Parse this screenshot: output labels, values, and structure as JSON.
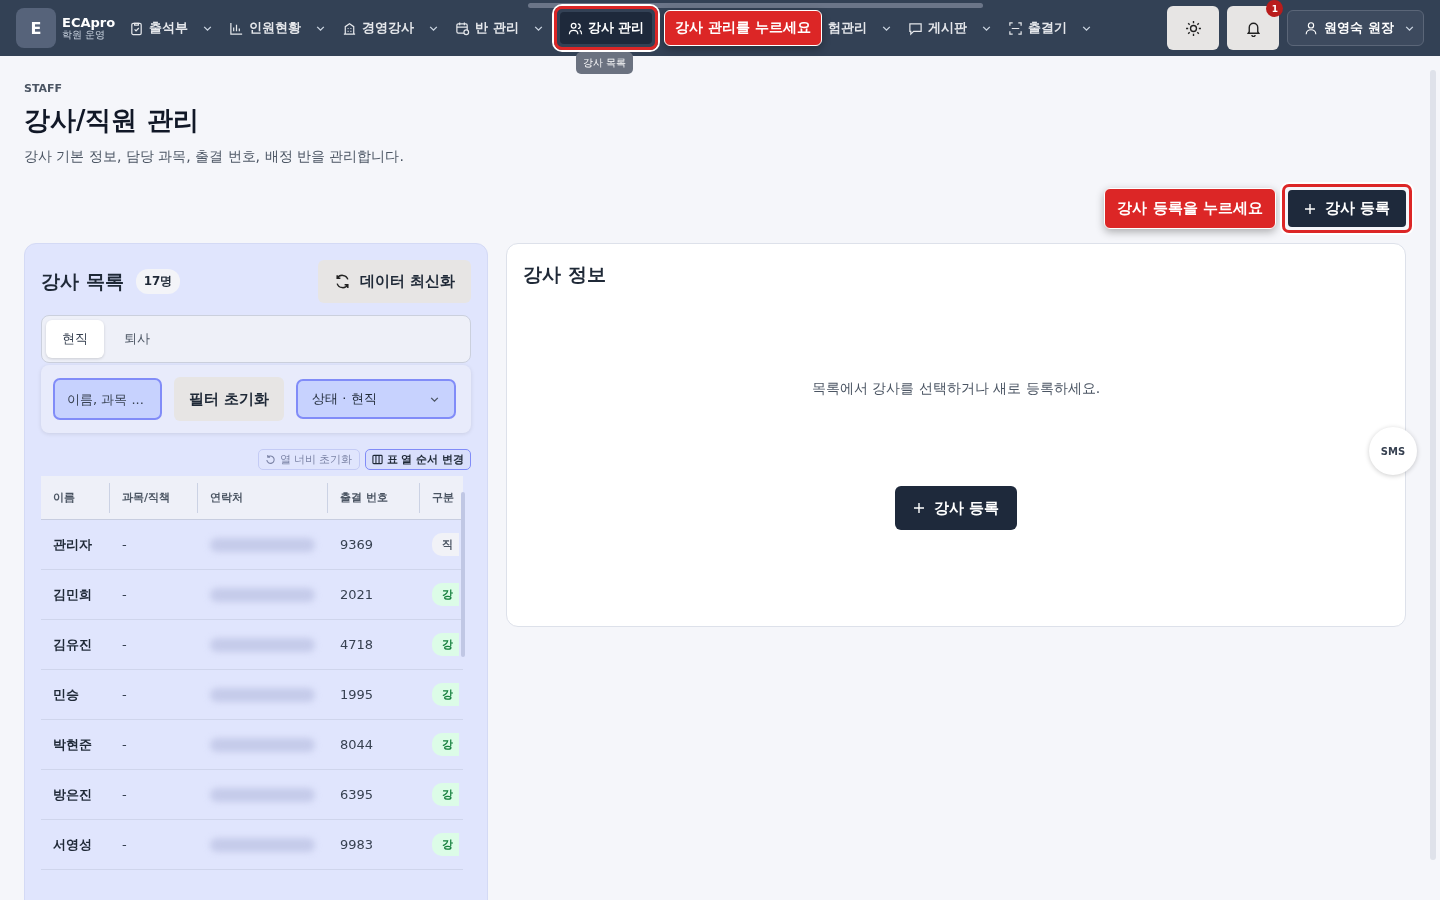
{
  "brand": {
    "logo": "E",
    "name": "ECApro",
    "sub": "학원 운영"
  },
  "nav": [
    {
      "label": "출석부",
      "selected": false
    },
    {
      "label": "인원현황",
      "selected": false
    },
    {
      "label": "경영강사",
      "selected": false
    },
    {
      "label": "반 관리",
      "selected": false
    },
    {
      "label": "강사 관리",
      "selected": true
    },
    {
      "label": "험관리",
      "selected": false
    },
    {
      "label": "게시판",
      "selected": false
    },
    {
      "label": "출결기",
      "selected": false
    }
  ],
  "nav_callout": "강사 관리를 누르세요",
  "nav_tooltip": "강사 목록",
  "notification_count": "1",
  "user": "원영숙 원장",
  "eyebrow": "STAFF",
  "title": "강사/직원 관리",
  "subtitle": "강사 기본 정보, 담당 과목, 출결 번호, 배정 반을 관리합니다.",
  "add_callout": "강사 등록을 누르세요",
  "add_button": "강사 등록",
  "list": {
    "title": "강사 목록",
    "count": "17명",
    "refresh": "데이터 최신화",
    "tabs": [
      {
        "label": "현직",
        "selected": true
      },
      {
        "label": "퇴사",
        "selected": false
      }
    ],
    "search": {
      "placeholder": "이름, 과목 ..."
    },
    "reset": "필터 초기화",
    "status": "상태 · 현직",
    "width_reset": {
      "label": "열 너비 초기화",
      "disabled": true
    },
    "column_order": "표 열 순서 변경",
    "columns": [
      "이름",
      "과목/직책",
      "연락처",
      "출결 번호",
      "구분"
    ],
    "rows": [
      {
        "name": "관리자",
        "subject": "-",
        "code": "9369",
        "kind": "staff",
        "badge": "직"
      },
      {
        "name": "김민희",
        "subject": "-",
        "code": "2021",
        "kind": "teacher",
        "badge": "강"
      },
      {
        "name": "김유진",
        "subject": "-",
        "code": "4718",
        "kind": "teacher",
        "badge": "강"
      },
      {
        "name": "민승",
        "subject": "-",
        "code": "1995",
        "kind": "teacher",
        "badge": "강"
      },
      {
        "name": "박현준",
        "subject": "-",
        "code": "8044",
        "kind": "teacher",
        "badge": "강"
      },
      {
        "name": "방은진",
        "subject": "-",
        "code": "6395",
        "kind": "teacher",
        "badge": "강"
      },
      {
        "name": "서영성",
        "subject": "-",
        "code": "9983",
        "kind": "teacher",
        "badge": "강"
      }
    ]
  },
  "detail": {
    "title": "강사 정보",
    "empty": "목록에서 강사를 선택하거나 새로 등록하세요.",
    "button": "강사 등록"
  },
  "sms": "SMS"
}
